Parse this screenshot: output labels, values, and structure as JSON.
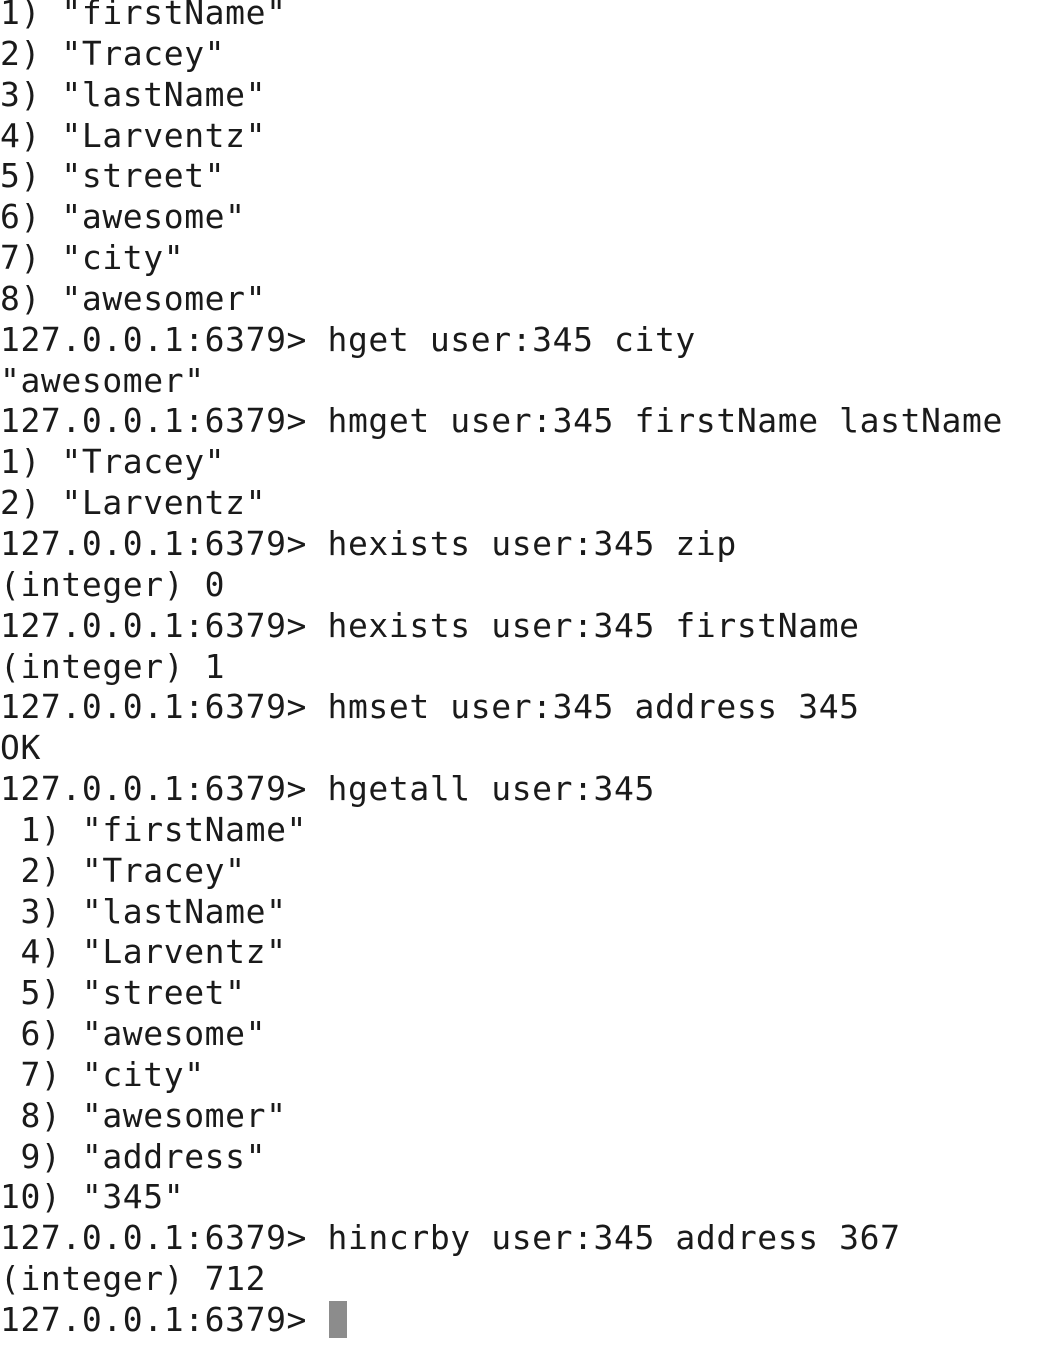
{
  "terminal": {
    "prompt": "127.0.0.1:6379> ",
    "cursor_color": "#8c8c8c",
    "lines": [
      "1) \"firstName\"",
      "2) \"Tracey\"",
      "3) \"lastName\"",
      "4) \"Larventz\"",
      "5) \"street\"",
      "6) \"awesome\"",
      "7) \"city\"",
      "8) \"awesomer\"",
      "127.0.0.1:6379> hget user:345 city",
      "\"awesomer\"",
      "127.0.0.1:6379> hmget user:345 firstName lastName",
      "1) \"Tracey\"",
      "2) \"Larventz\"",
      "127.0.0.1:6379> hexists user:345 zip",
      "(integer) 0",
      "127.0.0.1:6379> hexists user:345 firstName",
      "(integer) 1",
      "127.0.0.1:6379> hmset user:345 address 345",
      "OK",
      "127.0.0.1:6379> hgetall user:345",
      " 1) \"firstName\"",
      " 2) \"Tracey\"",
      " 3) \"lastName\"",
      " 4) \"Larventz\"",
      " 5) \"street\"",
      " 6) \"awesome\"",
      " 7) \"city\"",
      " 8) \"awesomer\"",
      " 9) \"address\"",
      "10) \"345\"",
      "127.0.0.1:6379> hincrby user:345 address 367",
      "(integer) 712"
    ]
  }
}
